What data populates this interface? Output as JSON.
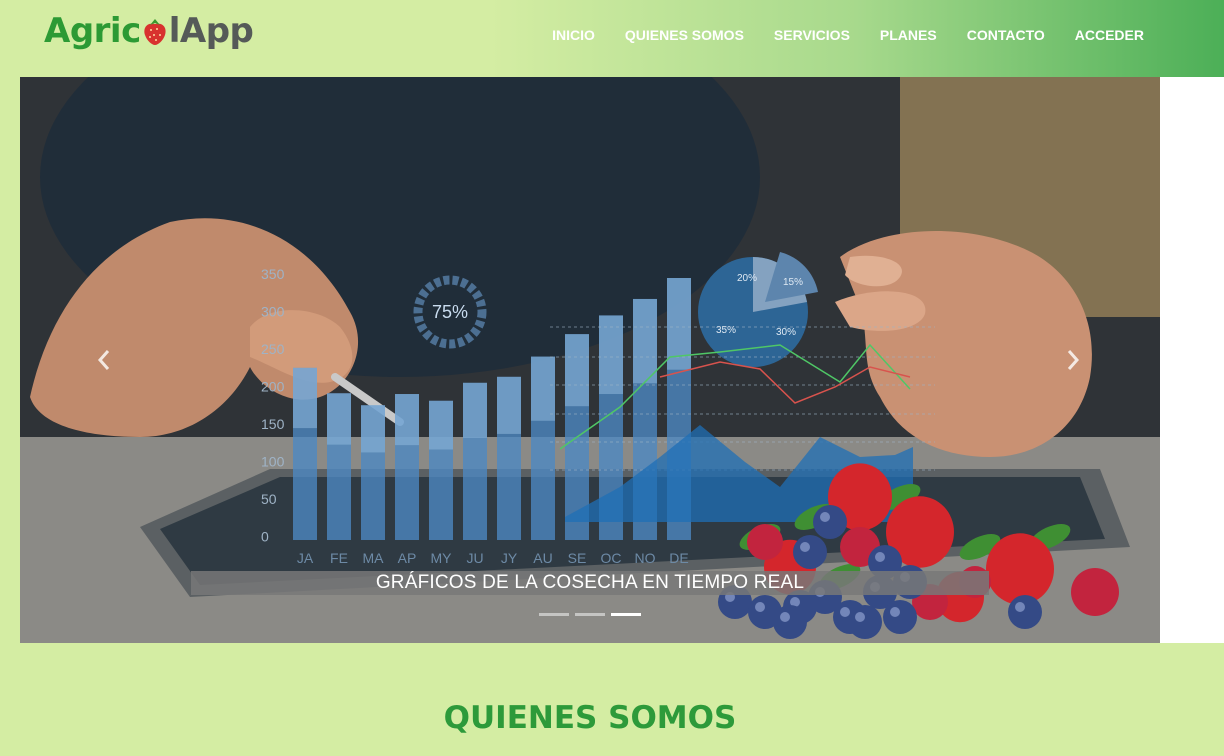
{
  "logo": {
    "part1": "Agric",
    "part2": "lApp",
    "icon": "strawberry-icon"
  },
  "nav": {
    "items": [
      {
        "label": "INICIO"
      },
      {
        "label": "QUIENES SOMOS"
      },
      {
        "label": "SERVICIOS"
      },
      {
        "label": "PLANES"
      },
      {
        "label": "CONTACTO"
      },
      {
        "label": "ACCEDER"
      }
    ]
  },
  "carousel": {
    "caption": "GRÁFICOS DE LA COSECHA EN TIEMPO REAL",
    "prev_icon": "chevron-left-icon",
    "next_icon": "chevron-right-icon",
    "indicators": 3,
    "active_index": 2,
    "overlay": {
      "y_ticks": [
        "350",
        "300",
        "250",
        "200",
        "150",
        "100",
        "50",
        "0"
      ],
      "months": [
        "JA",
        "FE",
        "MA",
        "AP",
        "MY",
        "JU",
        "JY",
        "AU",
        "SE",
        "OC",
        "NO",
        "DE"
      ],
      "bar_values": [
        230,
        196,
        180,
        195,
        186,
        210,
        218,
        245,
        275,
        300,
        322,
        350
      ],
      "gauge_label": "75%",
      "pie_labels": [
        "20%",
        "15%",
        "35%",
        "30%"
      ]
    }
  },
  "colors": {
    "brand_green": "#2d9a3a",
    "page_bg": "#d4eda3",
    "nav_end": "#4caf57"
  },
  "section": {
    "title": "QUIENES SOMOS"
  }
}
